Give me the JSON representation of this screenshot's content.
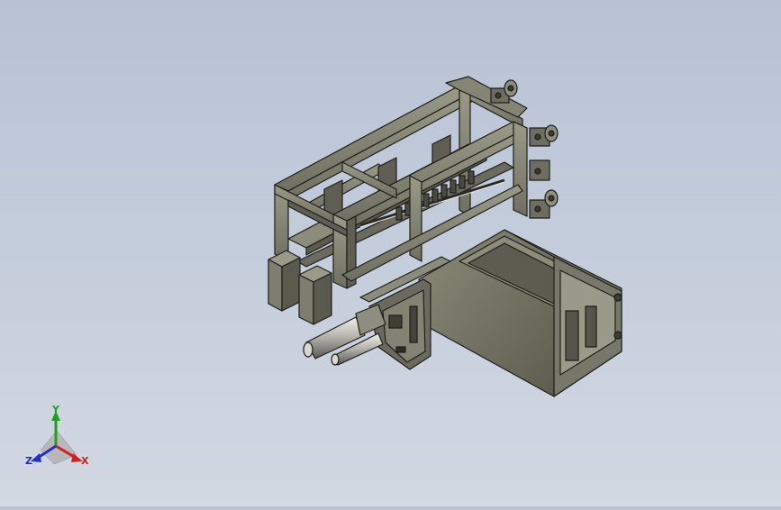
{
  "viewport": {
    "model": "machine-assembly",
    "background": {
      "top": "#b8c2d3",
      "bottom": "#d3d8e2"
    },
    "part_color": "#7a7a6a",
    "edge_color": "#1e1e1a"
  },
  "triad": {
    "x_label": "X",
    "y_label": "Y",
    "z_label": "Z",
    "x_color": "#d42020",
    "y_color": "#20a020",
    "z_color": "#2030c8"
  }
}
